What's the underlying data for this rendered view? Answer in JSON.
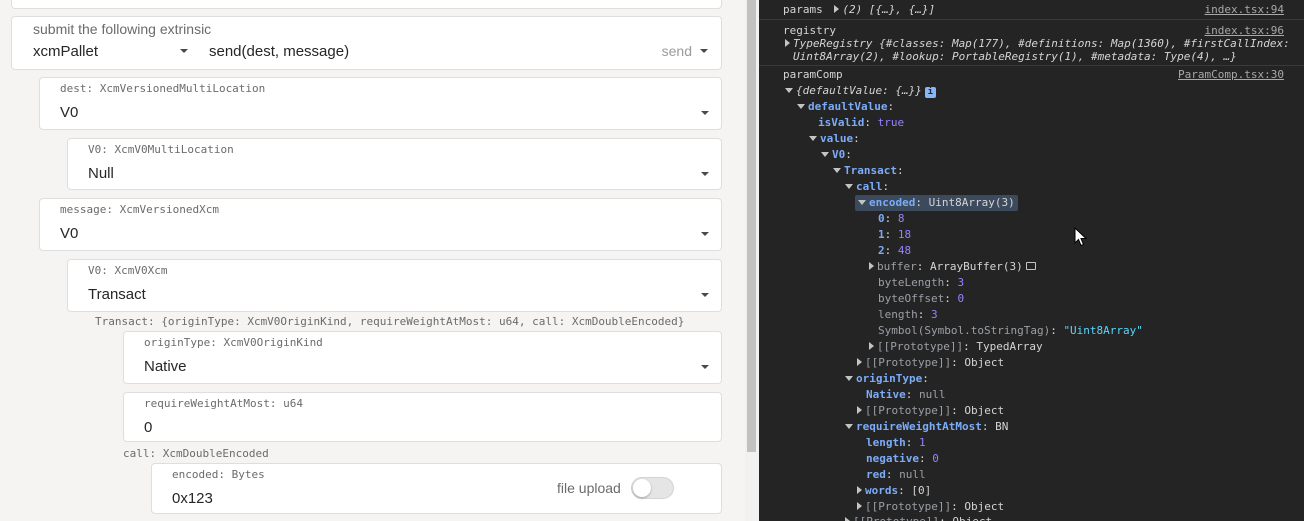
{
  "extrinsic": {
    "heading": "submit the following extrinsic",
    "pallet": "xcmPallet",
    "method": "send(dest, message)",
    "action": "send"
  },
  "params": {
    "dest": {
      "label": "dest: XcmVersionedMultiLocation",
      "value": "V0"
    },
    "dest_v0": {
      "label": "V0: XcmV0MultiLocation",
      "value": "Null"
    },
    "message": {
      "label": "message: XcmVersionedXcm",
      "value": "V0"
    },
    "message_v0": {
      "label": "V0: XcmV0Xcm",
      "value": "Transact"
    },
    "transact_caption": "Transact: {originType: XcmV0OriginKind, requireWeightAtMost: u64, call: XcmDoubleEncoded}",
    "origin_type": {
      "label": "originType: XcmV0OriginKind",
      "value": "Native"
    },
    "require_weight": {
      "label": "requireWeightAtMost: u64",
      "value": "0"
    },
    "call_caption": "call: XcmDoubleEncoded",
    "encoded": {
      "label": "encoded: Bytes",
      "value": "0x123",
      "file_upload_label": "file upload",
      "file_upload_on": false
    }
  },
  "console": {
    "params": {
      "key": "params",
      "preview": "(2) [{…}, {…}]",
      "source": "index.tsx:94"
    },
    "registry": {
      "key": "registry",
      "source": "index.tsx:96",
      "line1": "TypeRegistry {#classes: Map(177), #definitions: Map(1360), #firstCallIndex:",
      "line2": "Uint8Array(2), #lookup: PortableRegistry(1), #metadata: Type(4), …}"
    },
    "paramComp": {
      "key": "paramComp",
      "source": "ParamComp.tsx:30",
      "preview": "{defaultValue: {…}}",
      "info_badge": "i",
      "defaultValue": "defaultValue",
      "isValid_key": "isValid",
      "isValid_val": "true",
      "value_key": "value",
      "v0_key": "V0",
      "transact_key": "Transact",
      "call_key": "call",
      "encoded_key": "encoded",
      "encoded_val": "Uint8Array(3)",
      "bytes": [
        {
          "k": "0",
          "v": "8"
        },
        {
          "k": "1",
          "v": "18"
        },
        {
          "k": "2",
          "v": "48"
        }
      ],
      "buffer_key": "buffer",
      "buffer_val": "ArrayBuffer(3)",
      "byteLength_key": "byteLength",
      "byteLength_val": "3",
      "byteOffset_key": "byteOffset",
      "byteOffset_val": "0",
      "length_key": "length",
      "length_val": "3",
      "symbol_key": "Symbol(Symbol.toStringTag)",
      "symbol_val": "\"Uint8Array\"",
      "proto_key": "[[Prototype]]",
      "proto_typed": "TypedArray",
      "proto_object": "Object",
      "originType_key": "originType",
      "native_key": "Native",
      "native_val": "null",
      "rwam_key": "requireWeightAtMost",
      "rwam_val": "BN",
      "bn_length_key": "length",
      "bn_length_val": "1",
      "negative_key": "negative",
      "negative_val": "0",
      "red_key": "red",
      "red_val": "null",
      "words_key": "words",
      "words_val": "[0]"
    }
  },
  "colors": {
    "console_bg": "#242424",
    "key_blue": "#7cacf8",
    "number_purple": "#9980ff",
    "string_cyan": "#5cd5fb"
  }
}
